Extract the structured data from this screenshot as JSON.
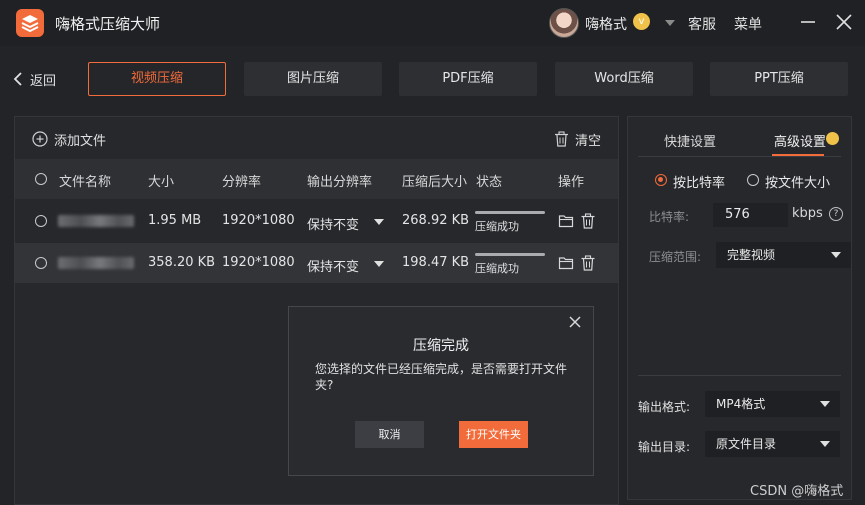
{
  "app": {
    "title": "嗨格式压缩大师",
    "logo_icon": "stack-layers-icon",
    "accent": "#f26b3a"
  },
  "header": {
    "username": "嗨格式",
    "vip_badge": "v",
    "service_label": "客服",
    "menu_label": "菜单"
  },
  "nav": {
    "back_label": "返回",
    "tabs": [
      {
        "label": "视频压缩",
        "active": true
      },
      {
        "label": "图片压缩",
        "active": false
      },
      {
        "label": "PDF压缩",
        "active": false
      },
      {
        "label": "Word压缩",
        "active": false
      },
      {
        "label": "PPT压缩",
        "active": false
      }
    ]
  },
  "toolbar": {
    "add_file_label": "添加文件",
    "clear_label": "清空"
  },
  "table": {
    "columns": [
      "文件名称",
      "大小",
      "分辨率",
      "输出分辨率",
      "压缩后大小",
      "状态",
      "操作"
    ],
    "rows": [
      {
        "size": "1.95 MB",
        "resolution": "1920*1080",
        "output_resolution": "保持不变",
        "compressed_size": "268.92 KB",
        "status": "压缩成功",
        "progress": 1.0
      },
      {
        "size": "358.20 KB",
        "resolution": "1920*1080",
        "output_resolution": "保持不变",
        "compressed_size": "198.47 KB",
        "status": "压缩成功",
        "progress": 1.0
      }
    ]
  },
  "settings": {
    "tabs": {
      "quick": "快捷设置",
      "advanced": "高级设置"
    },
    "mode_options": {
      "by_bitrate": "按比特率",
      "by_size": "按文件大小"
    },
    "bitrate_label": "比特率:",
    "bitrate_value": "576",
    "bitrate_unit": "kbps",
    "range_label": "压缩范围:",
    "range_value": "完整视频",
    "format_label": "输出格式:",
    "format_value": "MP4格式",
    "dir_label": "输出目录:",
    "dir_value": "原文件目录"
  },
  "dialog": {
    "title": "压缩完成",
    "message": "您选择的文件已经压缩完成，是否需要打开文件夹?",
    "cancel_label": "取消",
    "open_label": "打开文件夹"
  },
  "watermark": "CSDN @嗨格式"
}
